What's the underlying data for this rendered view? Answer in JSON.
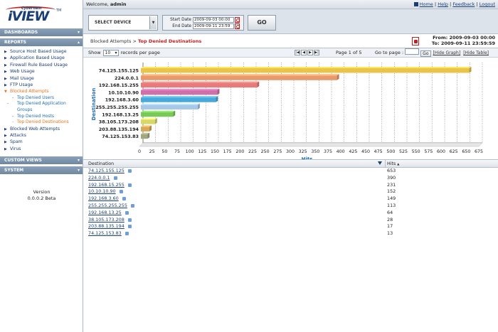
{
  "app": {
    "brand_small": "Cyberoam",
    "brand": "iVIEW",
    "tm": "TM",
    "version_label": "Version",
    "version": "0.0.0.2 Beta"
  },
  "sidebar": {
    "dashboards": "DASHBOARDS",
    "reports": "REPORTS",
    "custom_views": "CUSTOM VIEWS",
    "system": "SYSTEM",
    "items": [
      {
        "label": "Source Host Based Usage"
      },
      {
        "label": "Application Based Usage"
      },
      {
        "label": "Firewall Rule Based Usage"
      },
      {
        "label": "Web Usage"
      },
      {
        "label": "Mail Usage"
      },
      {
        "label": "FTP Usage"
      },
      {
        "label": "Blocked Attempts"
      },
      {
        "label": "Blocked Web Attempts"
      },
      {
        "label": "Attacks"
      },
      {
        "label": "Spam"
      },
      {
        "label": "Virus"
      }
    ],
    "sub_items": [
      {
        "label": "Top Denied Users"
      },
      {
        "label": "Top Denied Application Groups"
      },
      {
        "label": "Top Denied Hosts"
      },
      {
        "label": "Top Denied Destinations"
      }
    ]
  },
  "topbar": {
    "welcome": "Welcome,",
    "user": "admin",
    "home": "Home",
    "help": "Help",
    "feedback": "Feedback",
    "logout": "Logout"
  },
  "filters": {
    "device": "SELECT DEVICE",
    "start_label": "Start Date",
    "start_value": "2009-09-03 00:00",
    "end_label": "End Date",
    "end_value": "2009-09-11 23:59",
    "go": "GO"
  },
  "header": {
    "crumb_parent": "Blocked Attempts",
    "crumb_sep": " > ",
    "crumb_current": "Top Denied Destinations",
    "from": "From: 2009-09-03 00:00",
    "to": "To: 2009-09-11 23:59:59"
  },
  "toolbar": {
    "show": "Show",
    "rpp": "10",
    "rpp_suffix": "records per page",
    "page_info": "Page 1 of 5",
    "goto": "Go to page :",
    "go": "Go",
    "hide_graph": "[Hide Graph]",
    "hide_table": "[Hide Table]"
  },
  "chart_data": {
    "type": "bar",
    "orientation": "horizontal",
    "ylabel": "Destination",
    "xlabel": "Hits",
    "xlim": [
      0,
      675
    ],
    "xticks": [
      0,
      25,
      50,
      75,
      100,
      125,
      150,
      175,
      200,
      225,
      250,
      275,
      300,
      325,
      350,
      375,
      400,
      425,
      450,
      475,
      500,
      525,
      550,
      575,
      600,
      625,
      650,
      675
    ],
    "categories": [
      "74.125.155.125",
      "224.0.0.1",
      "192.168.15.255",
      "10.10.10.90",
      "192.168.3.60",
      "255.255.255.255",
      "192.168.13.25",
      "38.105.173.208",
      "203.88.135.194",
      "74.125.153.83"
    ],
    "values": [
      653,
      390,
      231,
      152,
      149,
      113,
      64,
      28,
      17,
      13
    ],
    "colors": [
      "#e8c44a",
      "#e89a6a",
      "#e87a7a",
      "#d070a8",
      "#4aa8d8",
      "#a8c8e8",
      "#7ac85a",
      "#d8d86a",
      "#d8a85a",
      "#a0a880"
    ]
  },
  "table": {
    "col_destination": "Destination",
    "col_hits": "Hits",
    "sort_icon": "▲",
    "rows": [
      {
        "dest": "74.125.155.125",
        "hits": "653"
      },
      {
        "dest": "224.0.0.1",
        "hits": "390"
      },
      {
        "dest": "192.168.15.255",
        "hits": "231"
      },
      {
        "dest": "10.10.10.90",
        "hits": "152"
      },
      {
        "dest": "192.168.3.60",
        "hits": "149"
      },
      {
        "dest": "255.255.255.255",
        "hits": "113"
      },
      {
        "dest": "192.168.13.25",
        "hits": "64"
      },
      {
        "dest": "38.105.173.208",
        "hits": "28"
      },
      {
        "dest": "203.88.135.194",
        "hits": "17"
      },
      {
        "dest": "74.125.153.83",
        "hits": "13"
      }
    ]
  }
}
